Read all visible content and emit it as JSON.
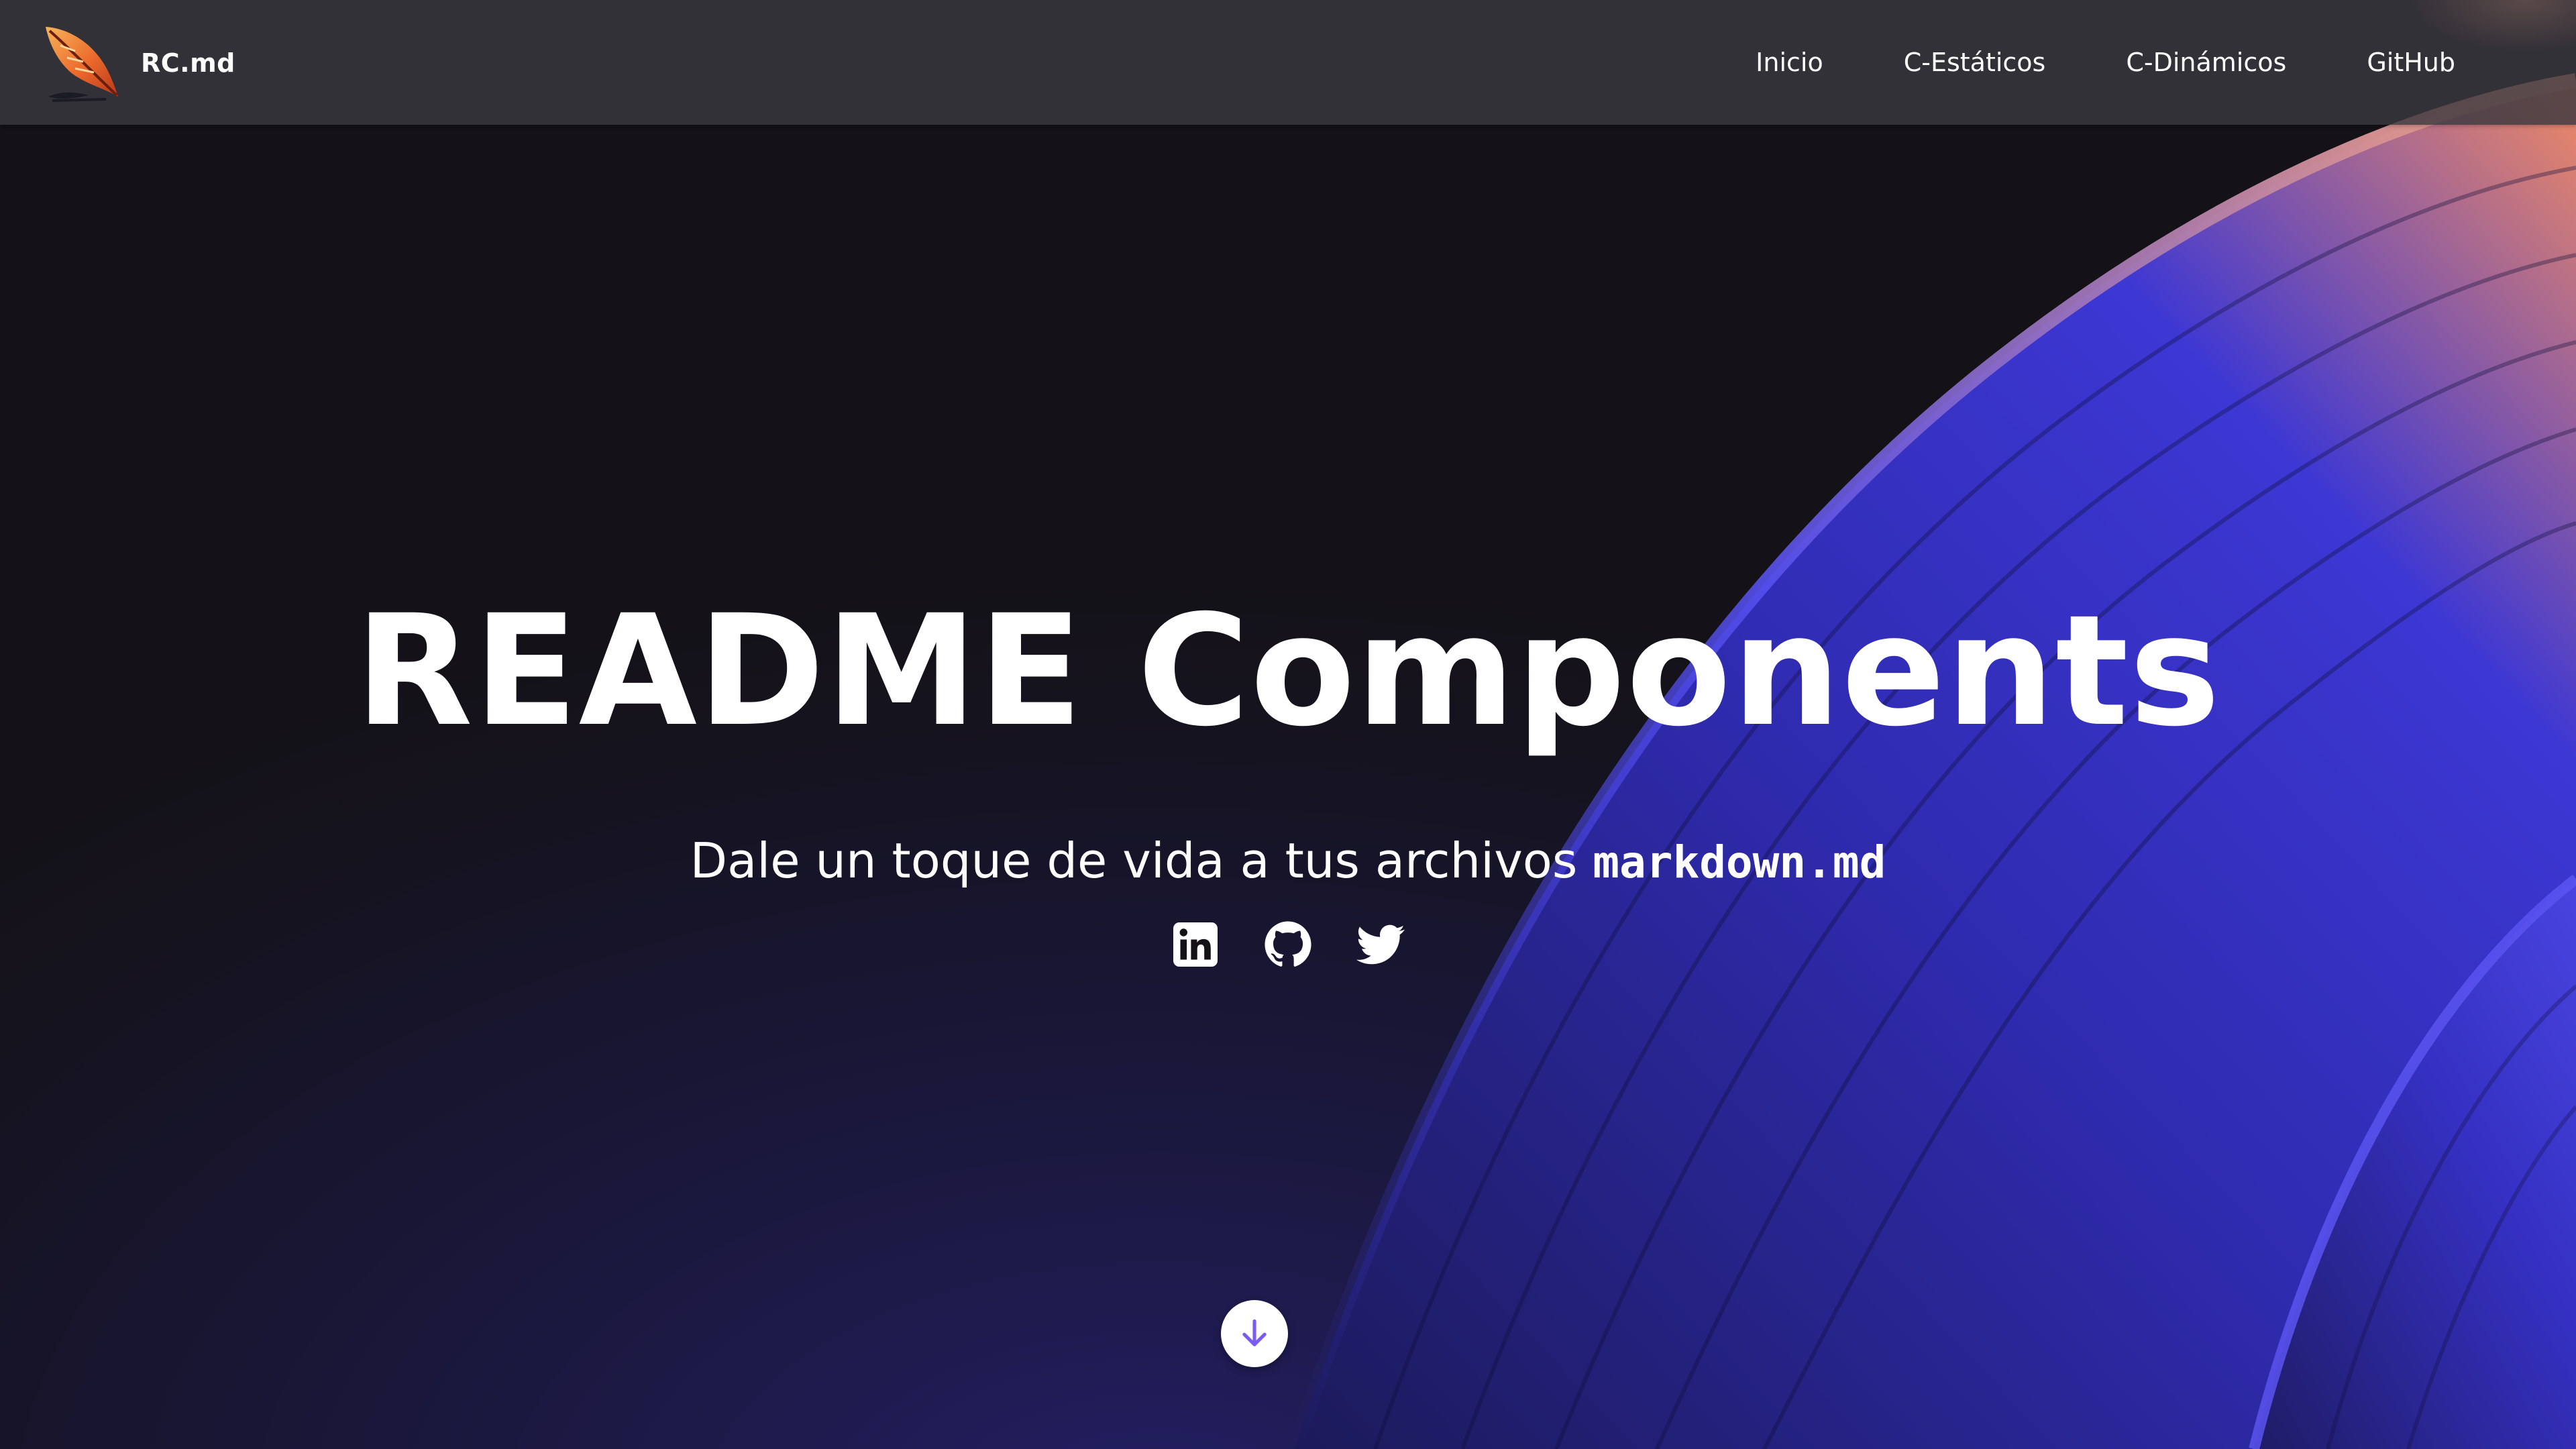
{
  "brand": {
    "name": "RC.md",
    "logo_icon": "quill-feather-icon"
  },
  "nav": {
    "items": [
      {
        "label": "Inicio"
      },
      {
        "label": "C-Estáticos"
      },
      {
        "label": "C-Dinámicos"
      },
      {
        "label": "GitHub"
      }
    ]
  },
  "hero": {
    "title": "README Components",
    "subtitle_text": "Dale un toque de vida a tus archivos ",
    "subtitle_code": "markdown.md"
  },
  "socials": [
    {
      "icon": "linkedin-icon"
    },
    {
      "icon": "github-icon"
    },
    {
      "icon": "twitter-icon"
    }
  ],
  "scroll": {
    "icon": "arrow-down-icon"
  },
  "colors": {
    "background": "#141216",
    "navbar": "#3a3840",
    "accent_blue": "#3a34c8",
    "accent_orange": "#f0906a",
    "arrow_purple": "#7b5cf0",
    "text": "#ffffff"
  }
}
